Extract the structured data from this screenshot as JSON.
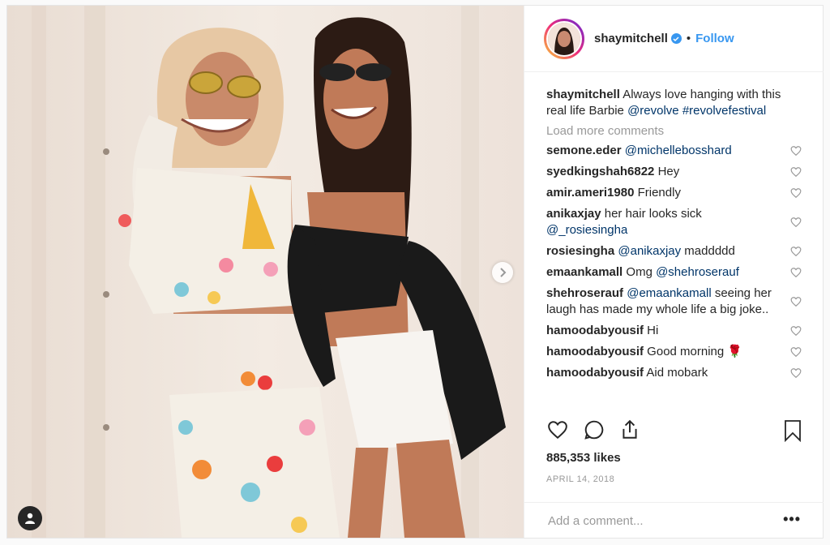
{
  "post": {
    "username": "shaymitchell",
    "dot": "•",
    "follow_label": "Follow",
    "caption": {
      "user": "shaymitchell",
      "text": " Always love hanging with this real life Barbie ",
      "mention": "@revolve",
      "hashtag": " #revolvefestival"
    },
    "load_more": "Load more comments",
    "comments": [
      {
        "user": "semone.eder",
        "text": "",
        "mention": " @michellebosshard"
      },
      {
        "user": "syedkingshah6822",
        "text": " Hey",
        "mention": ""
      },
      {
        "user": "amir.ameri1980",
        "text": " Friendly",
        "mention": ""
      },
      {
        "user": "anikaxjay",
        "text": " her hair looks sick ",
        "mention": "@_rosiesingha"
      },
      {
        "user": "rosiesingha",
        "text": "",
        "mention": " @anikaxjay",
        "text2": " maddddd"
      },
      {
        "user": "emaankamall",
        "text": " Omg ",
        "mention": "@shehroserauf"
      },
      {
        "user": "shehroserauf",
        "text": " ",
        "mention": "@emaankamall",
        "text2": " seeing her laugh has made my whole life a big joke.."
      },
      {
        "user": "hamoodabyousif",
        "text": " Hi",
        "mention": ""
      },
      {
        "user": "hamoodabyousif",
        "text": " Good morning 🌹",
        "mention": ""
      },
      {
        "user": "hamoodabyousif",
        "text": " Aid mobark",
        "mention": ""
      }
    ],
    "likes": "885,353 likes",
    "date": "APRIL 14, 2018",
    "add_comment_placeholder": "Add a comment...",
    "more_label": "•••"
  },
  "colors": {
    "link": "#003569",
    "accent": "#3897f0",
    "muted": "#999999"
  },
  "icons": [
    "heart-icon",
    "comment-icon",
    "share-icon",
    "bookmark-icon",
    "chevron-right-icon",
    "user-tag-icon",
    "verified-icon",
    "more-icon"
  ]
}
